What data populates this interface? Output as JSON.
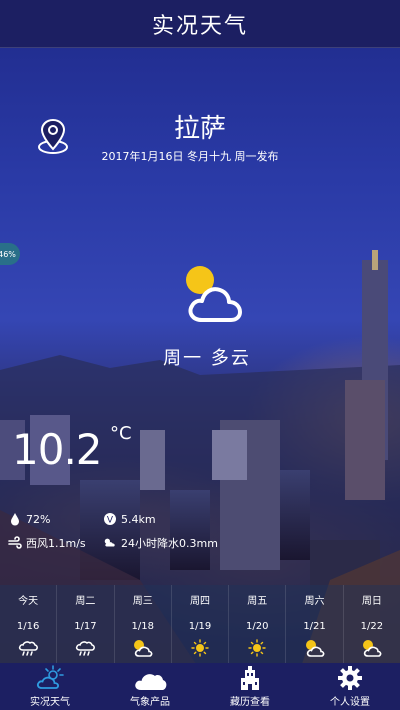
{
  "header": {
    "title": "实况天气"
  },
  "location": {
    "city": "拉萨",
    "publish_info": "2017年1月16日 冬月十九 周一发布",
    "icon": "location-pin-icon"
  },
  "badge": {
    "text": "46%"
  },
  "current": {
    "icon": "partly-cloudy-icon",
    "condition": "周一 多云",
    "temperature": "10.2",
    "unit": "°C",
    "humidity": "72%",
    "visibility": "5.4km",
    "wind": "西风1.1m/s",
    "precipitation": "24小时降水0.3mm"
  },
  "forecast": [
    {
      "day": "今天",
      "date": "1/16",
      "icon": "rain-cloud-icon"
    },
    {
      "day": "周二",
      "date": "1/17",
      "icon": "rain-cloud-icon"
    },
    {
      "day": "周三",
      "date": "1/18",
      "icon": "partly-cloudy-icon"
    },
    {
      "day": "周四",
      "date": "1/19",
      "icon": "sun-icon"
    },
    {
      "day": "周五",
      "date": "1/20",
      "icon": "sun-icon"
    },
    {
      "day": "周六",
      "date": "1/21",
      "icon": "partly-cloudy-icon"
    },
    {
      "day": "周日",
      "date": "1/22",
      "icon": "partly-cloudy-icon"
    }
  ],
  "tabbar": [
    {
      "label": "实况天气",
      "icon": "weather-live-icon"
    },
    {
      "label": "气象产品",
      "icon": "cloud-icon"
    },
    {
      "label": "藏历查看",
      "icon": "palace-icon"
    },
    {
      "label": "个人设置",
      "icon": "gear-icon"
    }
  ],
  "colors": {
    "header_bg": "#1c1f62",
    "accent_sun": "#f5c518"
  }
}
